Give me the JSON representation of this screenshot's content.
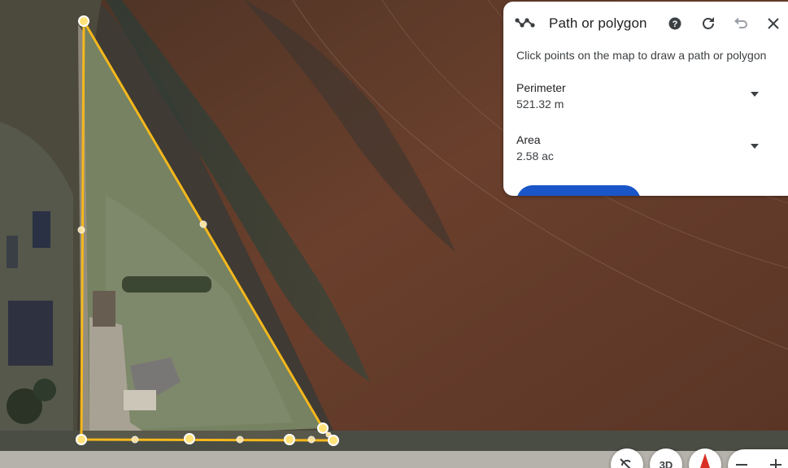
{
  "panel": {
    "title": "Path or polygon",
    "instructions": "Click points on the map to draw a path or polygon",
    "perimeter_label": "Perimeter",
    "perimeter_value": "521.32 m",
    "area_label": "Area",
    "area_value": "2.58 ac",
    "icons": [
      "path-icon",
      "help-icon",
      "refresh-icon",
      "undo-icon",
      "close-icon",
      "dropdown-arrow-icon"
    ]
  },
  "map_controls": {
    "three_d_label": "3D",
    "icons": [
      "rotate-icon",
      "compass-icon",
      "zoom-out-icon",
      "zoom-in-icon"
    ]
  },
  "colors": {
    "polygon_stroke": "#f5b81c",
    "vertex_fill": "#ffe27a",
    "panel_button": "#1a56c8",
    "field": "#5a3a2a",
    "lawn": "#6b7a5c"
  }
}
